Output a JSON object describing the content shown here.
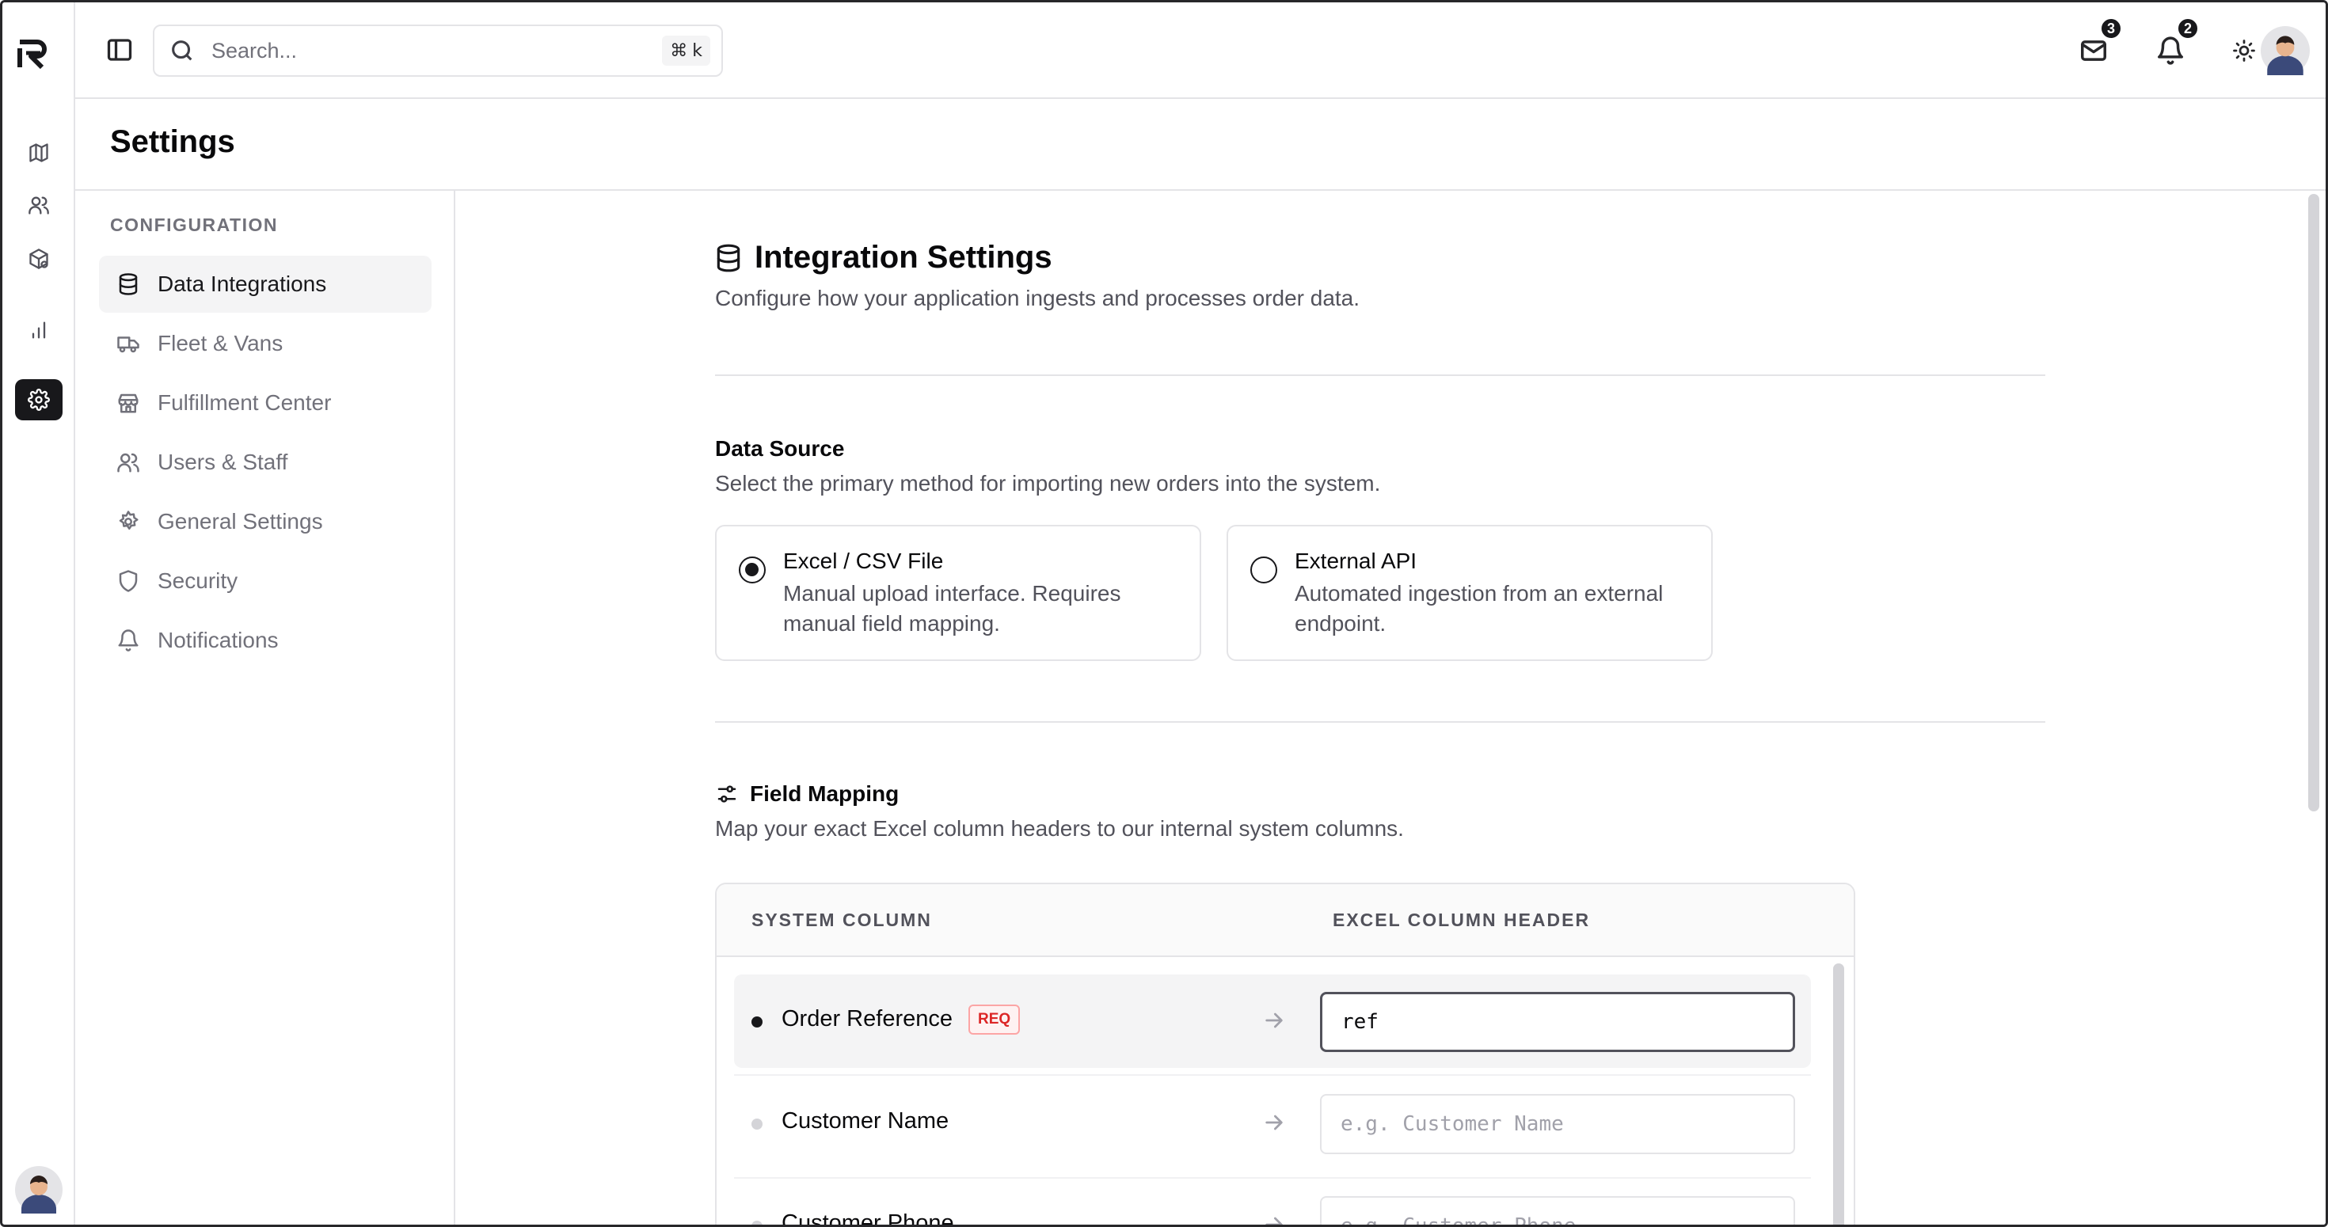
{
  "topbar": {
    "search_placeholder": "Search...",
    "search_shortcut_symbol": "⌘",
    "search_shortcut_key": "k",
    "mail_badge": "3",
    "notifications_badge": "2"
  },
  "rail": {
    "items": [
      {
        "name": "map",
        "icon": "map-icon"
      },
      {
        "name": "users",
        "icon": "users-icon"
      },
      {
        "name": "packages",
        "icon": "package-icon"
      },
      {
        "name": "analytics",
        "icon": "bar-chart-icon"
      },
      {
        "name": "settings",
        "icon": "gear-icon",
        "active": true
      }
    ]
  },
  "page": {
    "title": "Settings"
  },
  "settings_nav": {
    "section_label": "CONFIGURATION",
    "items": [
      {
        "label": "Data Integrations",
        "icon": "database-icon",
        "active": true
      },
      {
        "label": "Fleet & Vans",
        "icon": "truck-icon"
      },
      {
        "label": "Fulfillment Center",
        "icon": "store-icon"
      },
      {
        "label": "Users & Staff",
        "icon": "users-icon"
      },
      {
        "label": "General Settings",
        "icon": "gear-icon"
      },
      {
        "label": "Security",
        "icon": "shield-icon"
      },
      {
        "label": "Notifications",
        "icon": "bell-icon"
      }
    ]
  },
  "main": {
    "title": "Integration Settings",
    "description": "Configure how your application ingests and processes order data.",
    "data_source": {
      "heading": "Data Source",
      "description": "Select the primary method for importing new orders into the system.",
      "options": [
        {
          "title": "Excel / CSV File",
          "description": "Manual upload interface. Requires manual field mapping.",
          "selected": true
        },
        {
          "title": "External API",
          "description": "Automated ingestion from an external endpoint.",
          "selected": false
        }
      ]
    },
    "field_mapping": {
      "heading": "Field Mapping",
      "description": "Map your exact Excel column headers to our internal system columns.",
      "columns": [
        "SYSTEM COLUMN",
        "EXCEL COLUMN HEADER"
      ],
      "rows": [
        {
          "label": "Order Reference",
          "required_badge": "REQ",
          "value": "ref",
          "placeholder": ""
        },
        {
          "label": "Customer Name",
          "value": "",
          "placeholder": "e.g. Customer Name"
        },
        {
          "label": "Customer Phone",
          "value": "",
          "placeholder": "e.g. Customer Phone"
        }
      ]
    }
  },
  "colors": {
    "accent": "#18181b",
    "required": "#dc2626",
    "muted_text": "#71717a",
    "border": "#e4e4e7"
  }
}
